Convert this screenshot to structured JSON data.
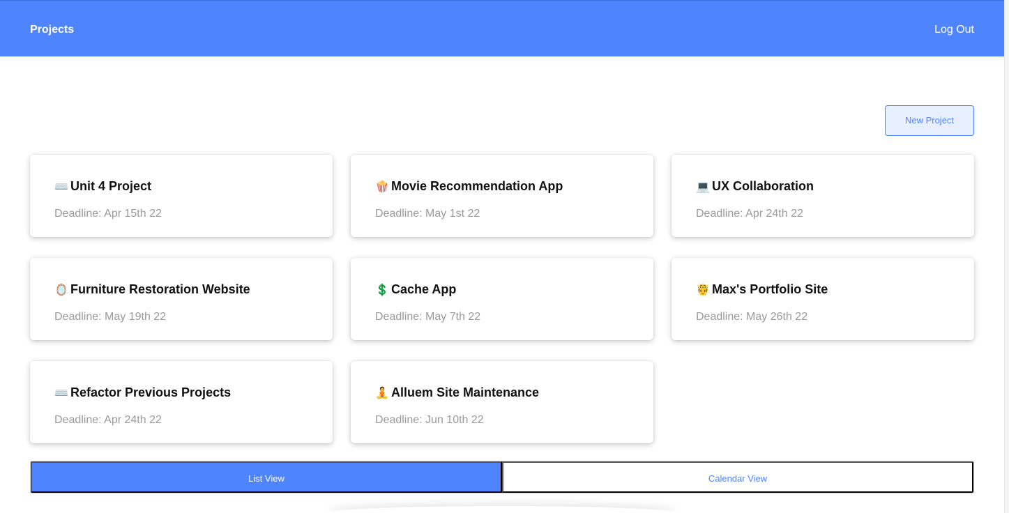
{
  "header": {
    "title": "Projects",
    "logout_label": "Log Out"
  },
  "actions": {
    "new_project_label": "New Project"
  },
  "projects": [
    {
      "emoji": "⌨️",
      "icon": "keyboard-icon",
      "title": "Unit 4 Project",
      "deadline": "Deadline: Apr 15th 22"
    },
    {
      "emoji": "🍿",
      "icon": "popcorn-icon",
      "title": "Movie Recommendation App",
      "deadline": "Deadline: May 1st 22"
    },
    {
      "emoji": "💻",
      "icon": "laptop-icon",
      "title": "UX Collaboration",
      "deadline": "Deadline: Apr 24th 22"
    },
    {
      "emoji": "🪞",
      "icon": "mirror-icon",
      "title": "Furniture Restoration Website",
      "deadline": "Deadline: May 19th 22"
    },
    {
      "emoji": "💲",
      "icon": "dollar-icon",
      "title": "Cache App",
      "deadline": "Deadline: May 7th 22"
    },
    {
      "emoji": "🤴",
      "icon": "prince-icon",
      "title": "Max's Portfolio Site",
      "deadline": "Deadline: May 26th 22"
    },
    {
      "emoji": "⌨️",
      "icon": "keyboard-icon",
      "title": "Refactor Previous Projects",
      "deadline": "Deadline: Apr 24th 22"
    },
    {
      "emoji": "🧘",
      "icon": "meditation-icon",
      "title": "Alluem Site Maintenance",
      "deadline": "Deadline: Jun 10th 22"
    }
  ],
  "view_toggle": {
    "list_label": "List View",
    "calendar_label": "Calendar View",
    "active": "list"
  },
  "colors": {
    "accent": "#4f84ff",
    "deadline_text": "#9a9a9a",
    "button_bg": "#e8efff"
  }
}
